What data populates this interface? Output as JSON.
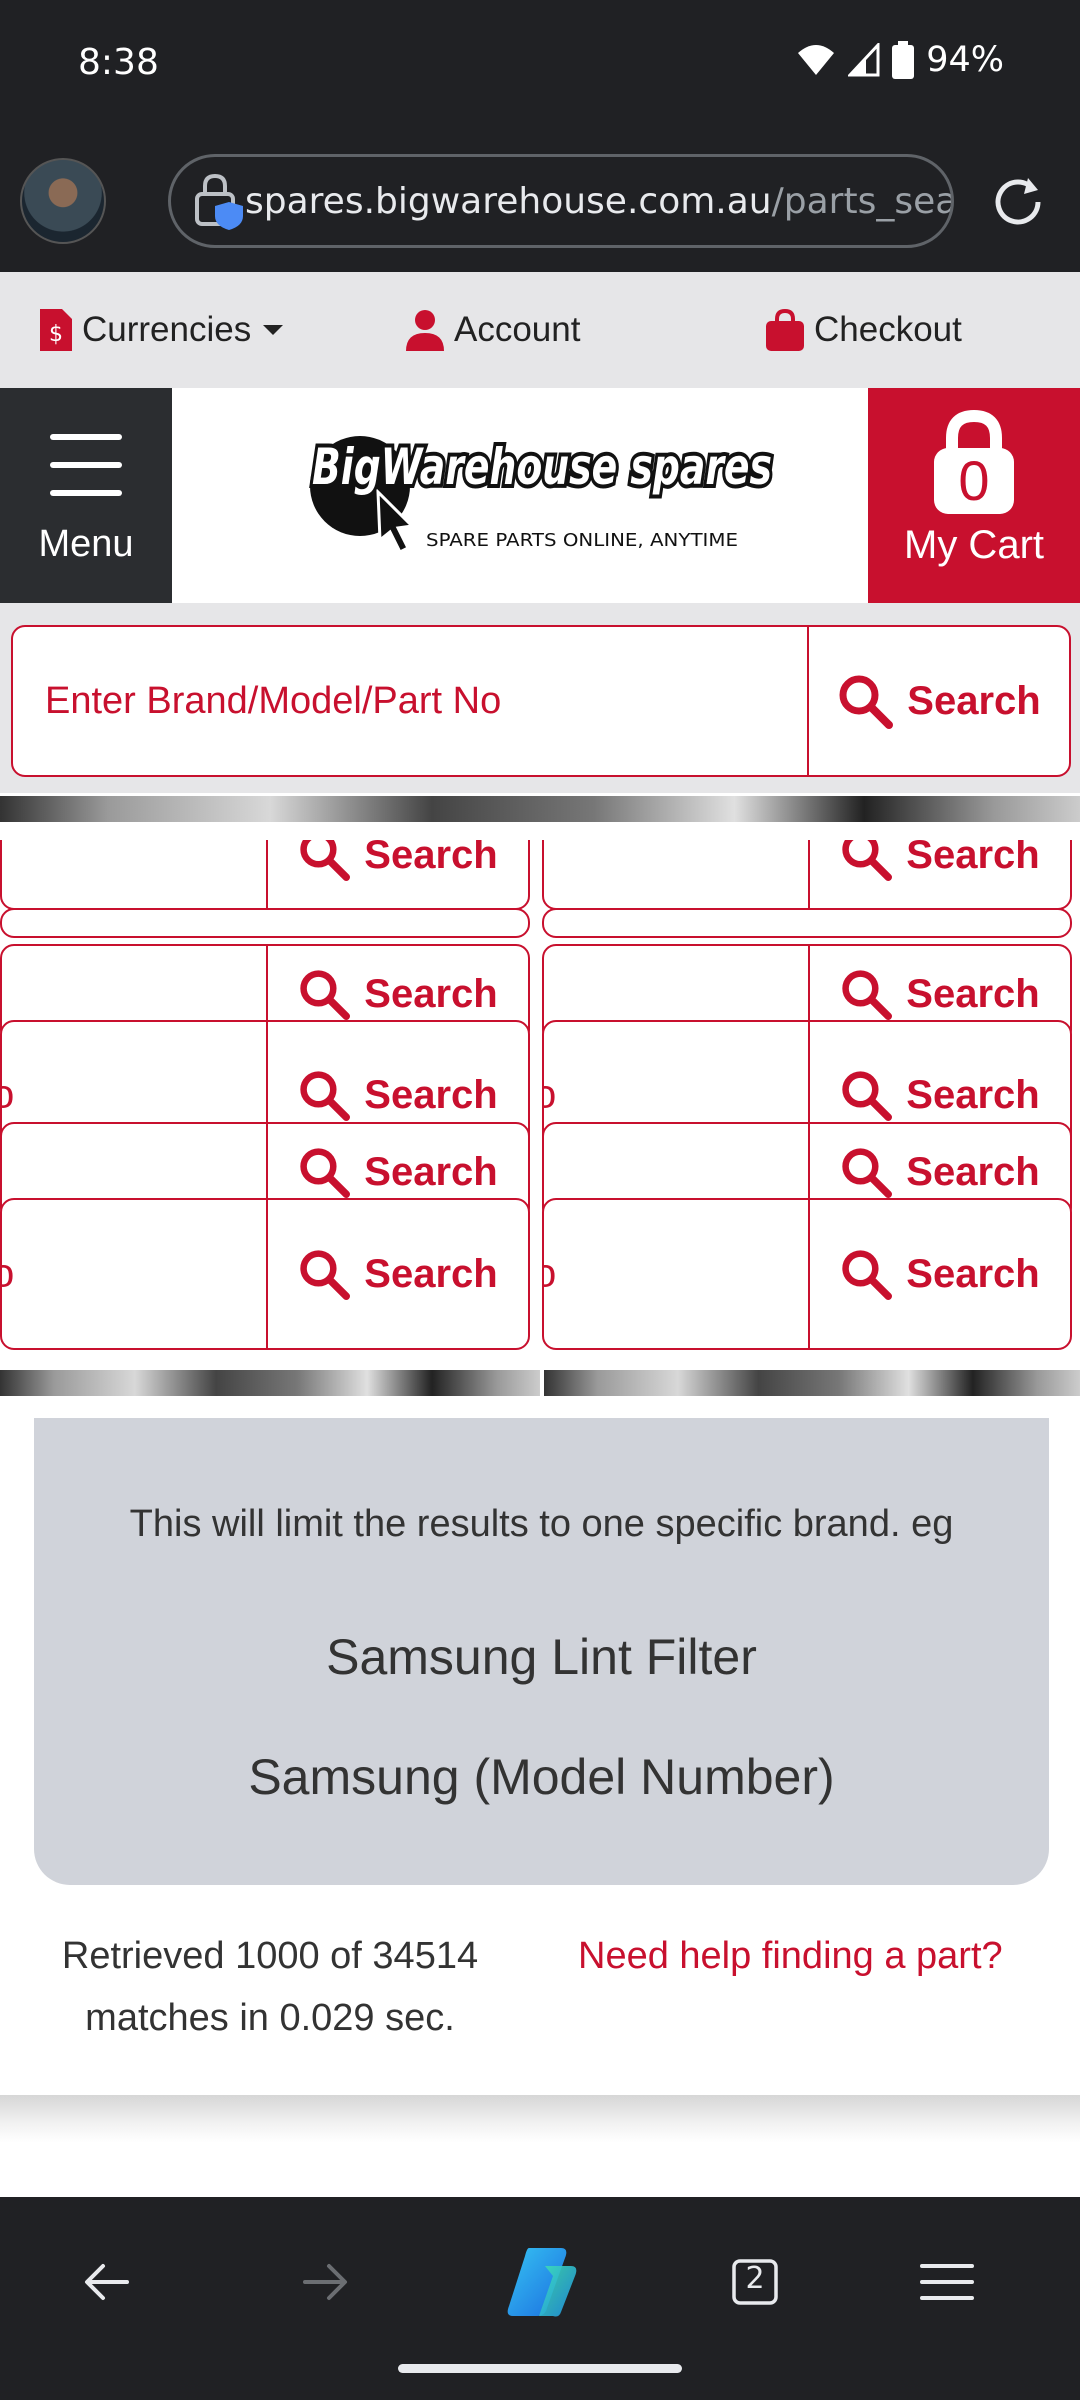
{
  "status": {
    "time": "8:38",
    "battery": "94%"
  },
  "browser": {
    "url_host": "spares.bigwarehouse.com.au",
    "url_path": "/parts_sea",
    "tab_count": "2"
  },
  "topnav": {
    "currencies": "Currencies",
    "account": "Account",
    "checkout": "Checkout"
  },
  "header": {
    "menu_label": "Menu",
    "logo_text": "BigWarehouse spares",
    "logo_tagline": "SPARE PARTS ONLINE, ANYTIME",
    "cart_count": "0",
    "cart_label": "My Cart"
  },
  "search": {
    "placeholder": "Enter Brand/Model/Part No",
    "button_label": "Search",
    "ghost_fragment": "o"
  },
  "info": {
    "line1": "This will limit the results to one specific brand. eg",
    "example1": "Samsung Lint Filter",
    "example2": "Samsung (Model Number)"
  },
  "results": {
    "summary": "Retrieved 1000 of 34514 matches in 0.029 sec.",
    "help_link": "Need help finding a part?"
  },
  "colors": {
    "brand_red": "#c8102e",
    "dark": "#202124"
  }
}
